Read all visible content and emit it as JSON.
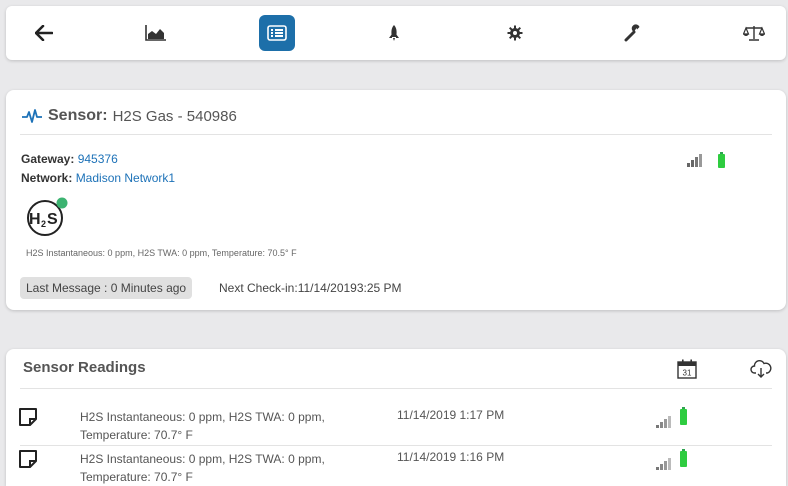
{
  "toolbar": {
    "items": [
      {
        "icon": "back-arrow-icon",
        "active": false
      },
      {
        "icon": "chart-icon",
        "active": false
      },
      {
        "icon": "list-icon",
        "active": true
      },
      {
        "icon": "rocket-icon",
        "active": false
      },
      {
        "icon": "gear-icon",
        "active": false
      },
      {
        "icon": "wrench-icon",
        "active": false
      },
      {
        "icon": "scale-icon",
        "active": false
      }
    ],
    "active_color": "#1d6fa9"
  },
  "sensor": {
    "label": "Sensor:",
    "name": "H2S Gas - 540986",
    "gateway_label": "Gateway:",
    "gateway_value": "945376",
    "network_label": "Network:",
    "network_value": "Madison Network1",
    "readout": "H2S Instantaneous: 0 ppm, H2S TWA: 0 ppm, Temperature: 70.5° F",
    "last_message": "Last Message : 0 Minutes ago",
    "next_checkin": "Next Check-in:11/14/20193:25 PM",
    "status_color": "#3cb371"
  },
  "readings": {
    "title": "Sensor Readings",
    "calendar_day": "31",
    "rows": [
      {
        "line1": "H2S Instantaneous: 0 ppm, H2S TWA: 0 ppm,",
        "line2": "Temperature: 70.7° F",
        "time": "11/14/2019 1:17 PM"
      },
      {
        "line1": "H2S Instantaneous: 0 ppm, H2S TWA: 0 ppm,",
        "line2": "Temperature: 70.7° F",
        "time": "11/14/2019 1:16 PM"
      }
    ]
  }
}
